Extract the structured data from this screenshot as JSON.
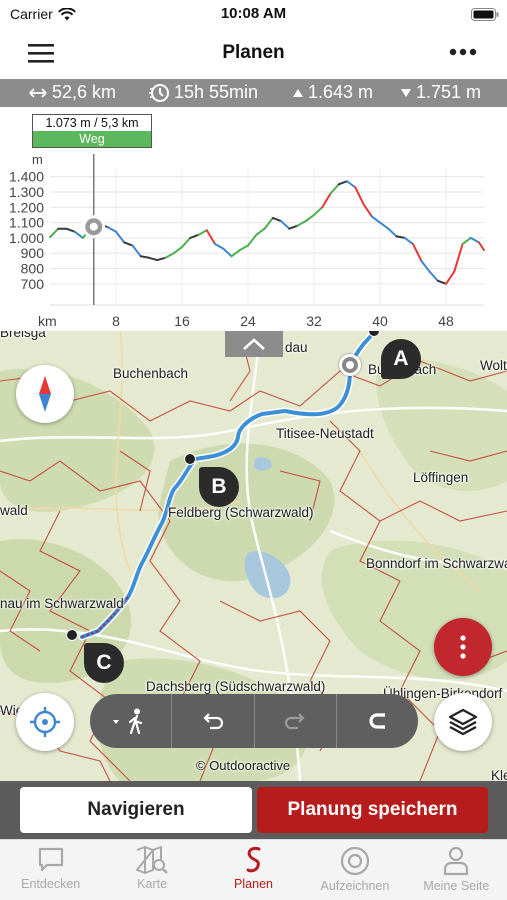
{
  "status_bar": {
    "carrier": "Carrier",
    "time": "10:08 AM"
  },
  "nav": {
    "title": "Planen"
  },
  "stats": {
    "distance": "52,6 km",
    "duration": "15h 55min",
    "ascent": "1.643 m",
    "descent": "1.751 m"
  },
  "profile": {
    "tooltip_value": "1.073 m / 5,3 km",
    "tooltip_surface": "Weg",
    "y_unit": "m",
    "x_unit": "km",
    "chart_data": {
      "type": "line",
      "title": "",
      "xlabel": "km",
      "ylabel": "m",
      "xlim": [
        0,
        52.6
      ],
      "ylim": [
        640,
        1450
      ],
      "y_ticks": [
        "1.400",
        "1.300",
        "1.200",
        "1.100",
        "1.000",
        "900",
        "800",
        "700"
      ],
      "x_ticks": [
        "8",
        "16",
        "24",
        "32",
        "40",
        "48"
      ],
      "x": [
        0,
        1,
        2,
        3,
        4,
        5,
        5.3,
        6,
        7,
        8,
        9,
        10,
        11,
        12,
        13,
        14,
        15,
        16,
        17,
        18,
        19,
        20,
        21,
        22,
        23,
        24,
        25,
        26,
        27,
        28,
        29,
        30,
        31,
        32,
        33,
        34,
        35,
        36,
        37,
        38,
        39,
        40,
        41,
        42,
        43,
        44,
        45,
        46,
        47,
        48,
        49,
        50,
        51,
        52,
        52.6
      ],
      "values": [
        1005,
        1060,
        1060,
        1040,
        1000,
        1070,
        1073,
        1090,
        1070,
        1040,
        970,
        950,
        880,
        870,
        855,
        870,
        900,
        940,
        1000,
        1020,
        1050,
        960,
        930,
        880,
        920,
        950,
        1020,
        1060,
        1130,
        1110,
        1060,
        1080,
        1110,
        1150,
        1200,
        1290,
        1350,
        1370,
        1330,
        1220,
        1140,
        1100,
        1060,
        1010,
        1000,
        960,
        850,
        780,
        720,
        700,
        780,
        960,
        1000,
        970,
        920
      ],
      "marker": {
        "x": 5.3,
        "y": 1073
      },
      "grade_colors": {
        "flat": "#3a3a3a",
        "up_gentle": "#4caf50",
        "down_gentle": "#3d86cf",
        "steep": "#e53935"
      }
    }
  },
  "map": {
    "labels": [
      "Buchenbach",
      "Titisee-Neustadt",
      "Löffingen",
      "Feldberg (Schwarzwald)",
      "Bonndorf im Schwarzwald",
      "Dachsberg (Südschwarzwald)",
      "Ühlingen-Birkendorf",
      "Bubenbach",
      "nau im Schwarzwald",
      "Wolte",
      "wald",
      "Wie",
      "Kle",
      "Breisga",
      "dau"
    ],
    "waypoints": [
      "A",
      "B",
      "C"
    ],
    "attribution": "© Outdooractive",
    "icons": {
      "compass": "compass-icon",
      "locate": "locate-crosshair-icon",
      "layers": "layers-icon",
      "more": "more-vertical-icon"
    },
    "colors": {
      "route": "#3d8fd6",
      "waypoint": "#2b2b2b",
      "accent": "#b71c1c"
    }
  },
  "toolbar": {
    "mode": "walking",
    "undo": "undo",
    "redo": "redo",
    "snap": "magnet"
  },
  "actions": {
    "navigate": "Navigieren",
    "save": "Planung speichern"
  },
  "tabs": [
    {
      "label": "Entdecken",
      "icon": "chat-bubble-icon"
    },
    {
      "label": "Karte",
      "icon": "map-search-icon"
    },
    {
      "label": "Planen",
      "icon": "route-s-icon",
      "active": true
    },
    {
      "label": "Aufzeichnen",
      "icon": "record-icon"
    },
    {
      "label": "Meine Seite",
      "icon": "user-icon"
    }
  ]
}
